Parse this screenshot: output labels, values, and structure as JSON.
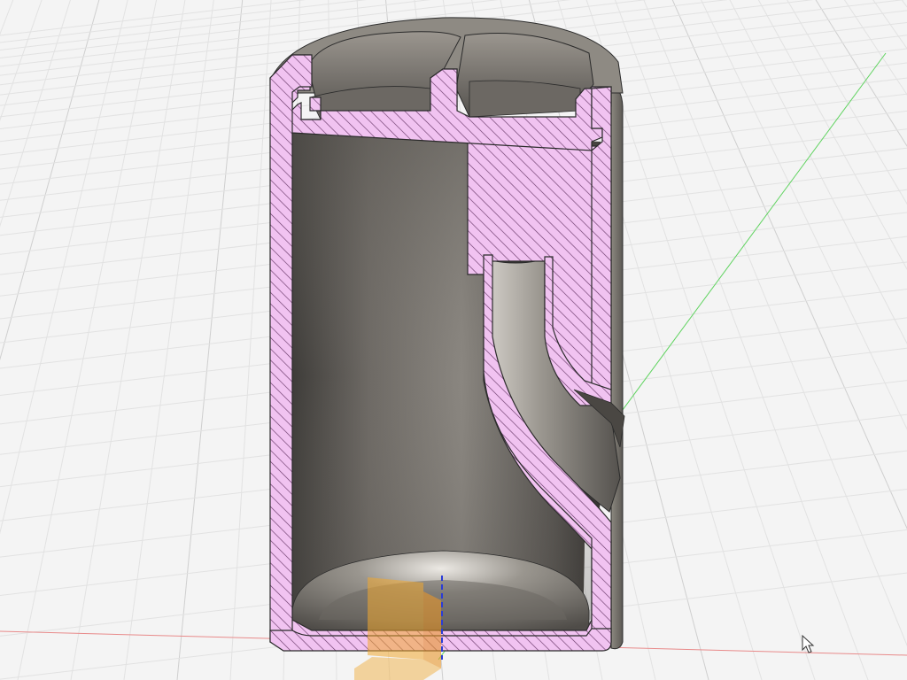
{
  "canvas": {
    "background": "#f4f4f4",
    "grid_color": "#cfcfcf",
    "grid_minor_color": "#e2e2e2"
  },
  "axes": {
    "x_axis_color": "#e88a8a",
    "y_axis_color": "#5fd35f",
    "z_axis_color": "#2a3cd6"
  },
  "model": {
    "section_hatch_fill": "#f1c3f1",
    "section_hatch_line": "#6a3a6a",
    "body_color": "#7a7670",
    "body_dark": "#4a4743",
    "body_light": "#b4b0aa",
    "outline_color": "#2b2b2b"
  },
  "gizmo": {
    "plane_color": "#f0a830",
    "plane_opacity": 0.55
  },
  "cursor": {
    "icon": "pointer-arrow-icon"
  }
}
